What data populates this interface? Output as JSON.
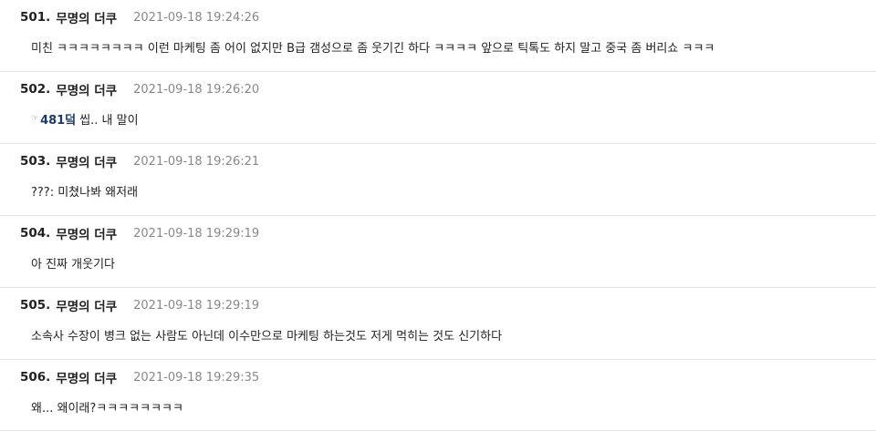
{
  "comments": [
    {
      "number": "501.",
      "author": "무명의 더쿠",
      "time": "2021-09-18 19:24:26",
      "text": "미친 ㅋㅋㅋㅋㅋㅋㅋㅋ 이런 마케팅 좀 어이 없지만 B급 갬성으로 좀 웃기긴 하다 ㅋㅋㅋㅋ 앞으로 틱톡도 하지 말고 중국 좀 버리쇼 ㅋㅋㅋ"
    },
    {
      "number": "502.",
      "author": "무명의 더쿠",
      "time": "2021-09-18 19:26:20",
      "reply_arrow": "☞",
      "reply_to": "481덬",
      "text": "씹.. 내 말이"
    },
    {
      "number": "503.",
      "author": "무명의 더쿠",
      "time": "2021-09-18 19:26:21",
      "text": "???: 미쳤나봐 왜저래"
    },
    {
      "number": "504.",
      "author": "무명의 더쿠",
      "time": "2021-09-18 19:29:19",
      "text": "아 진짜 개웃기다"
    },
    {
      "number": "505.",
      "author": "무명의 더쿠",
      "time": "2021-09-18 19:29:19",
      "text": "소속사 수장이 병크 없는 사람도 아닌데 이수만으로 마케팅 하는것도 저게 먹히는 것도 신기하다"
    },
    {
      "number": "506.",
      "author": "무명의 더쿠",
      "time": "2021-09-18 19:29:35",
      "text": "왜... 왜이래?ㅋㅋㅋㅋㅋㅋㅋㅋ"
    }
  ]
}
